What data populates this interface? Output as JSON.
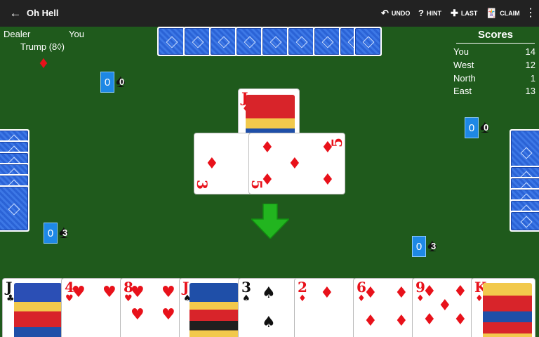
{
  "app": {
    "title": "Oh Hell"
  },
  "toolbar": {
    "undo_label": "UNDO",
    "hint_label": "HINT",
    "last_label": "LAST",
    "claim_label": "CLAIM"
  },
  "header": {
    "dealer_label": "Dealer",
    "dealer_name": "You",
    "trump_label": "Trump (8◊)"
  },
  "scores": {
    "title": "Scores",
    "rows": [
      {
        "name": "You",
        "score": "14"
      },
      {
        "name": "West",
        "score": "12"
      },
      {
        "name": "North",
        "score": "1"
      },
      {
        "name": "East",
        "score": "13"
      }
    ]
  },
  "bids": {
    "north": {
      "won": "0",
      "bid": "0"
    },
    "east": {
      "won": "0",
      "bid": "0"
    },
    "west": {
      "won": "0",
      "bid": "3"
    },
    "south": {
      "won": "0",
      "bid": "3"
    }
  },
  "trick": {
    "cards": [
      {
        "rank": "J",
        "suit": "♦",
        "color": "red"
      },
      {
        "rank": "3",
        "suit": "♦",
        "color": "red"
      },
      {
        "rank": "5",
        "suit": "♦",
        "color": "red"
      }
    ]
  },
  "hand": {
    "cards": [
      {
        "rank": "J",
        "suit": "♣",
        "color": "black"
      },
      {
        "rank": "4",
        "suit": "♥",
        "color": "red"
      },
      {
        "rank": "8",
        "suit": "♥",
        "color": "red"
      },
      {
        "rank": "J",
        "suit": "♠",
        "color": "black"
      },
      {
        "rank": "3",
        "suit": "♠",
        "color": "black"
      },
      {
        "rank": "2",
        "suit": "♦",
        "color": "red"
      },
      {
        "rank": "6",
        "suit": "♦",
        "color": "red"
      },
      {
        "rank": "9",
        "suit": "♦",
        "color": "red"
      },
      {
        "rank": "K",
        "suit": "♦",
        "color": "red"
      }
    ]
  },
  "colors": {
    "felt": "#1f5a1c",
    "topbar": "#222222",
    "bid_box": "#1e88e5",
    "card_back": "#2b63d6",
    "arrow": "#22b51f"
  }
}
